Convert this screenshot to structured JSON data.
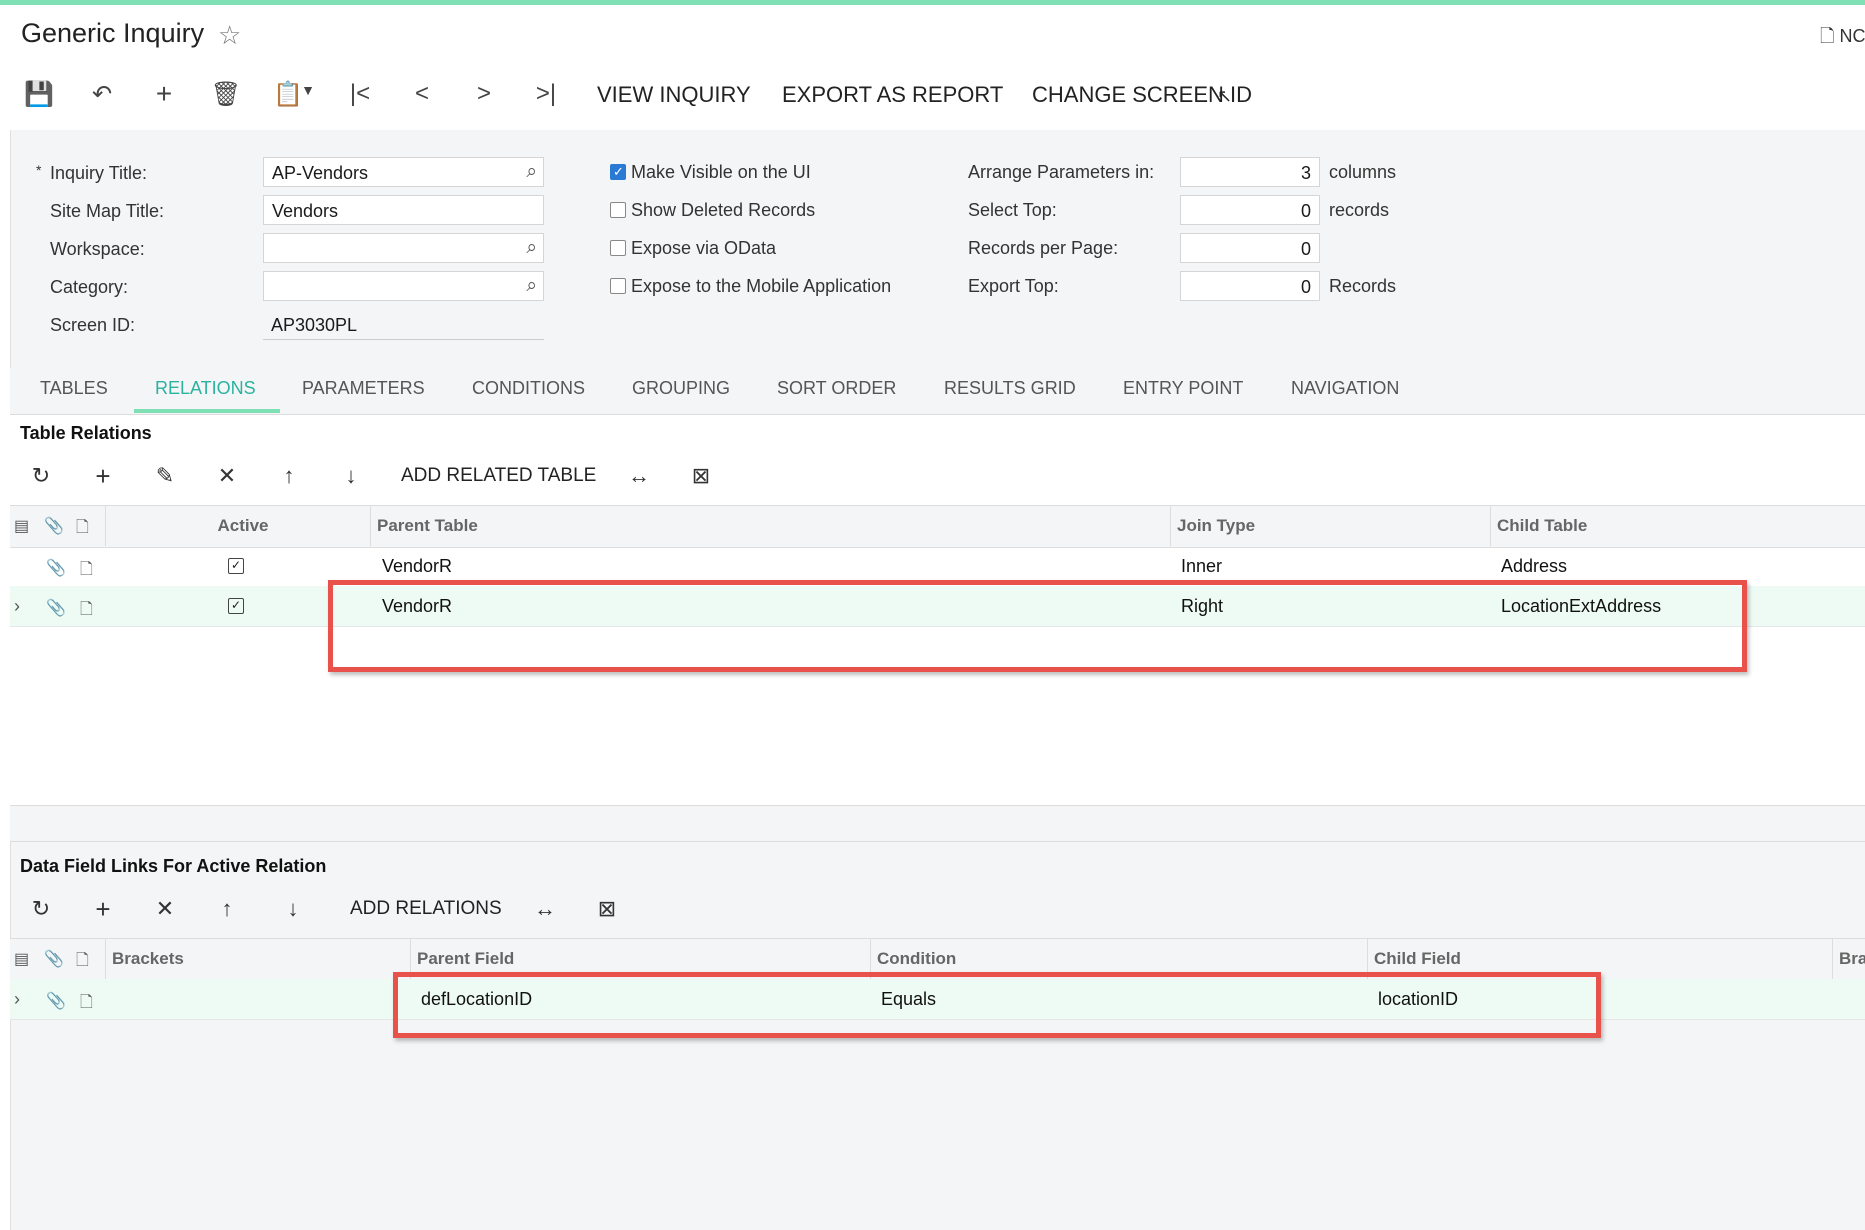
{
  "header": {
    "title": "Generic Inquiry",
    "notes_label": "NC"
  },
  "toolbar": {
    "view_inquiry": "VIEW INQUIRY",
    "export_as_report": "EXPORT AS REPORT",
    "change_screen_id": "CHANGE SCREEN ID"
  },
  "form": {
    "inquiry_title_label": "Inquiry Title:",
    "inquiry_title_value": "AP-Vendors",
    "required_mark": "*",
    "site_map_title_label": "Site Map Title:",
    "site_map_title_value": "Vendors",
    "workspace_label": "Workspace:",
    "workspace_value": "",
    "category_label": "Category:",
    "category_value": "",
    "screen_id_label": "Screen ID:",
    "screen_id_value": "AP3030PL",
    "make_visible_label": "Make Visible on the UI",
    "make_visible_checked": true,
    "show_deleted_label": "Show Deleted Records",
    "expose_odata_label": "Expose via OData",
    "expose_mobile_label": "Expose to the Mobile Application",
    "arrange_params_label": "Arrange Parameters in:",
    "arrange_params_value": "3",
    "arrange_params_unit": "columns",
    "select_top_label": "Select Top:",
    "select_top_value": "0",
    "select_top_unit": "records",
    "records_per_page_label": "Records per Page:",
    "records_per_page_value": "0",
    "export_top_label": "Export Top:",
    "export_top_value": "0",
    "export_top_unit": "Records"
  },
  "tabs": [
    {
      "label": "TABLES"
    },
    {
      "label": "RELATIONS"
    },
    {
      "label": "PARAMETERS"
    },
    {
      "label": "CONDITIONS"
    },
    {
      "label": "GROUPING"
    },
    {
      "label": "SORT ORDER"
    },
    {
      "label": "RESULTS GRID"
    },
    {
      "label": "ENTRY POINT"
    },
    {
      "label": "NAVIGATION"
    }
  ],
  "table_relations": {
    "title": "Table Relations",
    "add_related_table": "ADD RELATED TABLE",
    "columns": {
      "active": "Active",
      "parent_table": "Parent Table",
      "join_type": "Join Type",
      "child_table": "Child Table"
    },
    "rows": [
      {
        "active": true,
        "parent_table": "VendorR",
        "join_type": "Inner",
        "child_table": "Address"
      },
      {
        "active": true,
        "parent_table": "VendorR",
        "join_type": "Right",
        "child_table": "LocationExtAddress"
      }
    ]
  },
  "data_field_links": {
    "title": "Data Field Links For Active Relation",
    "add_relations": "ADD RELATIONS",
    "columns": {
      "brackets": "Brackets",
      "parent_field": "Parent Field",
      "condition": "Condition",
      "child_field": "Child Field",
      "brackets2": "Brac"
    },
    "rows": [
      {
        "parent_field": "defLocationID",
        "condition": "Equals",
        "child_field": "locationID"
      }
    ]
  }
}
